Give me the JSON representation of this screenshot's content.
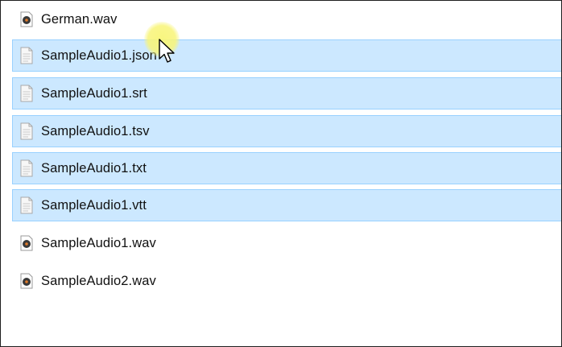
{
  "files": [
    {
      "name": "German.wav",
      "type": "audio",
      "icon": "audio-file-icon",
      "selected": false
    },
    {
      "name": "SampleAudio1.json",
      "type": "text",
      "icon": "text-file-icon",
      "selected": true
    },
    {
      "name": "SampleAudio1.srt",
      "type": "text",
      "icon": "text-file-icon",
      "selected": true
    },
    {
      "name": "SampleAudio1.tsv",
      "type": "text",
      "icon": "text-file-icon",
      "selected": true
    },
    {
      "name": "SampleAudio1.txt",
      "type": "text",
      "icon": "text-file-icon",
      "selected": true
    },
    {
      "name": "SampleAudio1.vtt",
      "type": "text",
      "icon": "text-file-icon",
      "selected": true
    },
    {
      "name": "SampleAudio1.wav",
      "type": "audio",
      "icon": "audio-file-icon",
      "selected": false
    },
    {
      "name": "SampleAudio2.wav",
      "type": "audio",
      "icon": "audio-file-icon",
      "selected": false
    }
  ],
  "colors": {
    "selection_fill": "#cce8ff",
    "selection_border": "#99d1ff",
    "cursor_highlight": "#f8f578"
  }
}
